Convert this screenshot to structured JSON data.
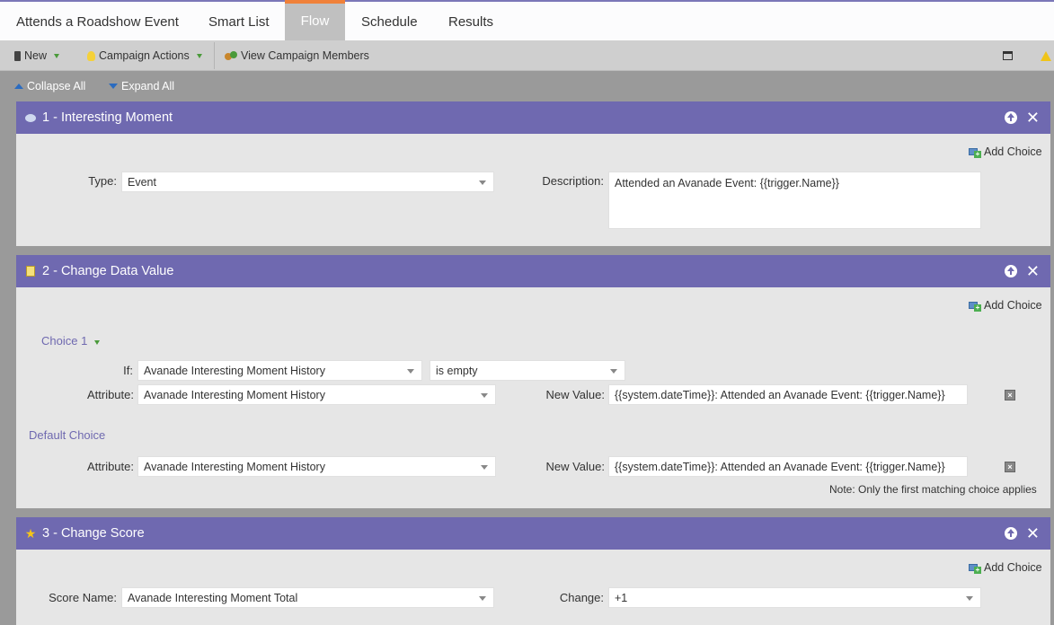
{
  "tabs": [
    {
      "label": "Attends a Roadshow Event"
    },
    {
      "label": "Smart List"
    },
    {
      "label": "Flow"
    },
    {
      "label": "Schedule"
    },
    {
      "label": "Results"
    }
  ],
  "toolbar": {
    "new_label": "New",
    "campaign_actions_label": "Campaign Actions",
    "view_members_label": "View Campaign Members"
  },
  "expand": {
    "collapse_label": "Collapse All",
    "expand_label": "Expand All"
  },
  "add_choice_label": "Add Choice",
  "steps": [
    {
      "title": "1 - Interesting Moment",
      "type_label": "Type:",
      "type_value": "Event",
      "description_label": "Description:",
      "description_value": "Attended an Avanade Event: {{trigger.Name}}"
    },
    {
      "title": "2 - Change Data Value",
      "choice1_label": "Choice 1",
      "if_label": "If:",
      "if_field": "Avanade Interesting Moment History",
      "if_operator": "is empty",
      "attribute_label": "Attribute:",
      "attribute_value": "Avanade Interesting Moment History",
      "new_value_label": "New Value:",
      "new_value": "{{system.dateTime}}: Attended an Avanade Event: {{trigger.Name}}",
      "default_choice_label": "Default Choice",
      "default_attribute_value": "Avanade Interesting Moment History",
      "default_new_value": "{{system.dateTime}}: Attended an Avanade Event: {{trigger.Name}}",
      "note": "Note: Only the first matching choice applies"
    },
    {
      "title": "3 - Change Score",
      "score_name_label": "Score Name:",
      "score_name_value": "Avanade Interesting Moment Total",
      "change_label": "Change:",
      "change_value": "+1"
    }
  ]
}
